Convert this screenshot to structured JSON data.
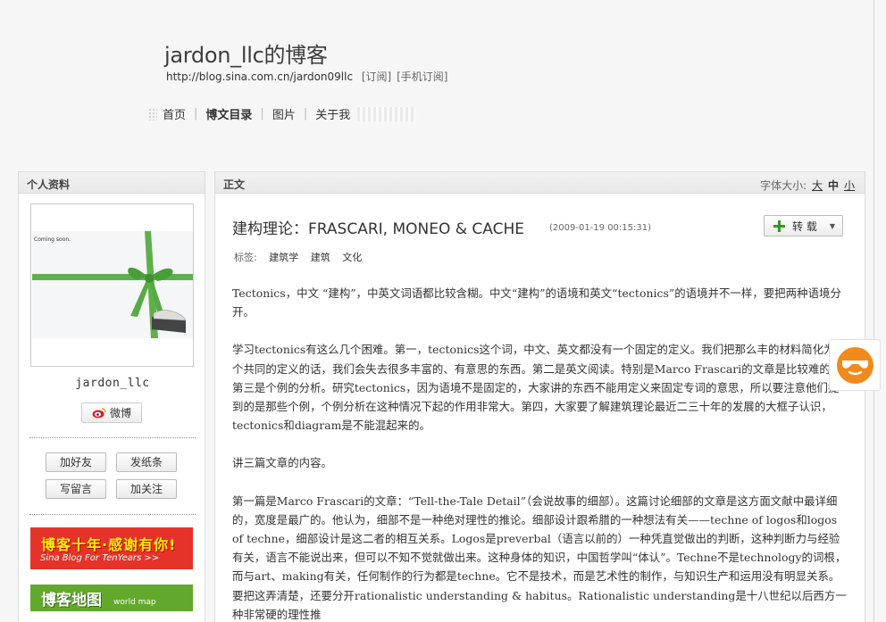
{
  "blog": {
    "title": "jardon_llc的博客",
    "url": "http://blog.sina.com.cn/jardon09llc",
    "subscribe": "[订阅]",
    "mobile_subscribe": "[手机订阅]"
  },
  "nav": {
    "items": [
      "首页",
      "博文目录",
      "图片",
      "关于我"
    ],
    "current_index": 1
  },
  "sidebar": {
    "header": "个人资料",
    "avatar_text": "Coming soon.",
    "username": "jardon_llc",
    "weibo_label": "微博",
    "actions": [
      "加好友",
      "发纸条",
      "写留言",
      "加关注"
    ],
    "banner1": {
      "title": "博客十年·感谢有你!",
      "subtitle": "Sina Blog For TenYears >>"
    },
    "banner2": {
      "title": "博客地图",
      "subtitle": "world map"
    }
  },
  "content": {
    "header": "正文",
    "font_size_label": "字体大小:",
    "font_sizes": [
      "大",
      "中",
      "小"
    ],
    "article_title": "建构理论：FRASCARI, MONEO & CACHE",
    "article_time": "(2009-01-19 00:15:31)",
    "share_label": "转 载",
    "tags_label": "标签:",
    "tags": [
      "建筑学",
      "建筑",
      "文化"
    ],
    "paragraphs": [
      "Tectonics，中文 “建构”，中英文词语都比较含糊。中文“建构”的语境和英文“tectonics”的语境并不一样，要把两种语境分开。",
      "学习tectonics有这么几个困难。第一，tectonics这个词，中文、英文都没有一个固定的定义。我们把那么丰的材料简化为一个共同的定义的话，我们会失去很多丰富的、有意思的东西。第二是英文阅读。特别是Marco Frascari的文章是比较难的。第三是个例的分析。研究tectonics，因为语境不是固定的，大家讲的东西不能用定义来固定专词的意思，所以要注意他们提到的是那些个例，个例分析在这种情况下起的作用非常大。第四，大家要了解建筑理论最近二三十年的发展的大框子认识，tectonics和diagram是不能混起来的。",
      "讲三篇文章的内容。",
      "第一篇是Marco Frascari的文章：“Tell-the-Tale Detail”（会说故事的细部）。这篇讨论细部的文章是这方面文献中最详细的，宽度是最广的。他认为，细部不是一种绝对理性的推论。细部设计跟希腊的一种想法有关——techne of logos和logos of techne，细部设计是这二者的相互关系。Logos是preverbal（语言以前的）一种凭直觉做出的判断，这种判断力与经验有关，语言不能说出来，但可以不知不觉就做出来。这种身体的知识，中国哲学叫“体认”。Techne不是technology的词根，而与art、making有关，任何制作的行为都是techne。它不是技术，而是艺术性的制作，与知识生产和运用没有明显关系。要把这弄清楚，还要分开rationalistic understanding & habitus。Rationalistic understanding是十八世纪以后西方一种非常硬的理性推"
    ]
  },
  "colors": {
    "page_bg": "#f6f6f6",
    "float_icon": "#f18a1c",
    "banner_red": "#e5332a",
    "banner_green": "#62a82c"
  }
}
